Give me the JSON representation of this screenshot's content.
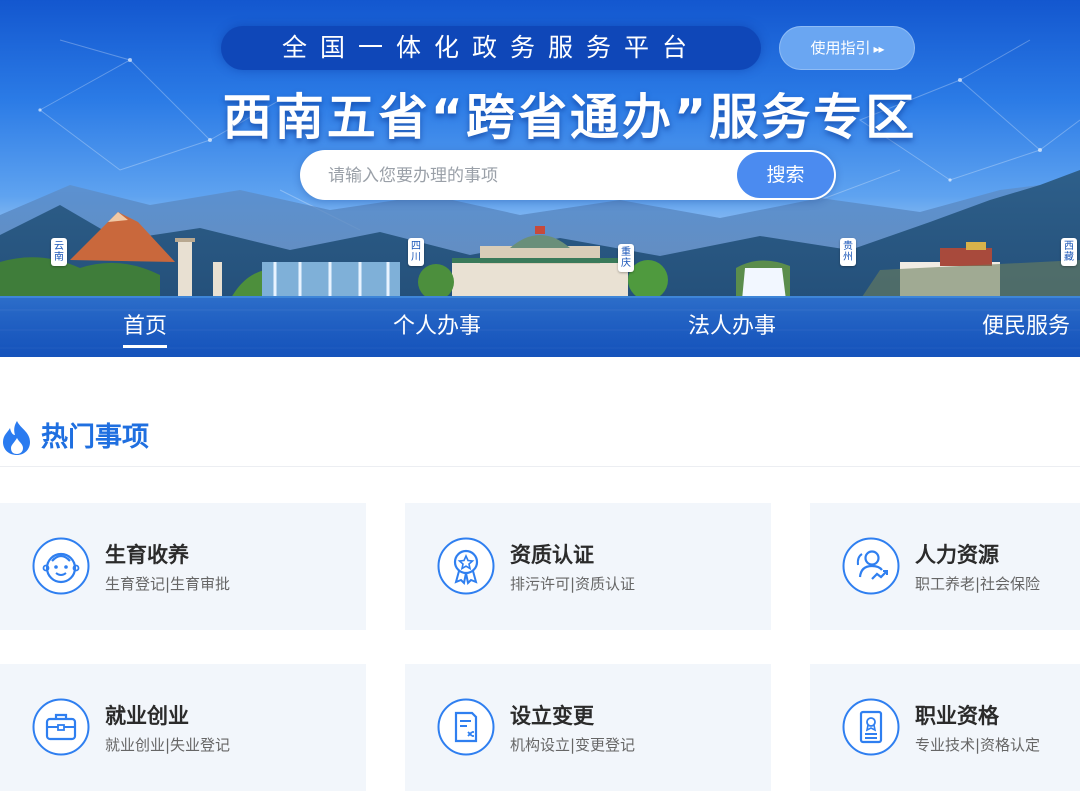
{
  "header": {
    "platform_name": "全国一体化政务服务平台",
    "guide_button": "使用指引",
    "guide_arrows": "▸▸",
    "title": "西南五省“跨省通办”服务专区"
  },
  "search": {
    "placeholder": "请输入您要办理的事项",
    "button": "搜索"
  },
  "provinces": [
    "云南",
    "四川",
    "重庆",
    "贵州",
    "西藏"
  ],
  "nav": {
    "items": [
      {
        "label": "首页",
        "active": true
      },
      {
        "label": "个人办事",
        "active": false
      },
      {
        "label": "法人办事",
        "active": false
      },
      {
        "label": "便民服务",
        "active": false
      }
    ]
  },
  "section": {
    "title": "热门事项",
    "cards": [
      {
        "title": "生育收养",
        "sub": "生育登记|生育审批",
        "icon": "baby-face-icon"
      },
      {
        "title": "资质认证",
        "sub": "排污许可|资质认证",
        "icon": "award-badge-icon"
      },
      {
        "title": "人力资源",
        "sub": "职工养老|社会保险",
        "icon": "people-growth-icon"
      },
      {
        "title": "就业创业",
        "sub": "就业创业|失业登记",
        "icon": "briefcase-icon"
      },
      {
        "title": "设立变更",
        "sub": "机构设立|变更登记",
        "icon": "document-shuffle-icon"
      },
      {
        "title": "职业资格",
        "sub": "专业技术|资格认定",
        "icon": "certificate-icon"
      }
    ]
  },
  "colors": {
    "accent": "#1f6fe0",
    "icon_blue": "#2f7ff0",
    "card_bg": "#f2f6fb",
    "search_button": "#4b8bf0"
  }
}
